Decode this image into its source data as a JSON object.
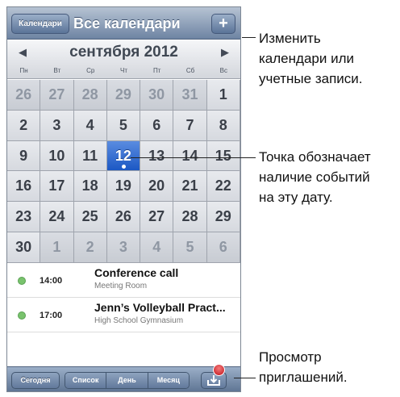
{
  "nav": {
    "calendars_button": "Календари",
    "title": "Все календари",
    "add_button": "+"
  },
  "month": {
    "title": "сентября 2012",
    "prev": "◀",
    "next": "▶",
    "weekdays": [
      "Пн",
      "Вт",
      "Ср",
      "Чт",
      "Пт",
      "Сб",
      "Вс"
    ]
  },
  "days": [
    {
      "d": "26",
      "out": true
    },
    {
      "d": "27",
      "out": true
    },
    {
      "d": "28",
      "out": true
    },
    {
      "d": "29",
      "out": true
    },
    {
      "d": "30",
      "out": true
    },
    {
      "d": "31",
      "out": true
    },
    {
      "d": "1"
    },
    {
      "d": "2"
    },
    {
      "d": "3"
    },
    {
      "d": "4"
    },
    {
      "d": "5"
    },
    {
      "d": "6"
    },
    {
      "d": "7"
    },
    {
      "d": "8"
    },
    {
      "d": "9"
    },
    {
      "d": "10"
    },
    {
      "d": "11"
    },
    {
      "d": "12",
      "selected": true,
      "has_events": true
    },
    {
      "d": "13"
    },
    {
      "d": "14"
    },
    {
      "d": "15"
    },
    {
      "d": "16"
    },
    {
      "d": "17"
    },
    {
      "d": "18"
    },
    {
      "d": "19"
    },
    {
      "d": "20"
    },
    {
      "d": "21"
    },
    {
      "d": "22"
    },
    {
      "d": "23"
    },
    {
      "d": "24"
    },
    {
      "d": "25"
    },
    {
      "d": "26"
    },
    {
      "d": "27"
    },
    {
      "d": "28"
    },
    {
      "d": "29"
    },
    {
      "d": "30"
    },
    {
      "d": "1",
      "out": true
    },
    {
      "d": "2",
      "out": true
    },
    {
      "d": "3",
      "out": true
    },
    {
      "d": "4",
      "out": true
    },
    {
      "d": "5",
      "out": true
    },
    {
      "d": "6",
      "out": true
    }
  ],
  "events": [
    {
      "time": "14:00",
      "title": "Conference call",
      "location": "Meeting Room",
      "color": "#79c36d"
    },
    {
      "time": "17:00",
      "title": "Jenn’s Volleyball Pract...",
      "location": "High School Gymnasium",
      "color": "#79c36d"
    }
  ],
  "toolbar": {
    "today": "Сегодня",
    "list": "Список",
    "day": "День",
    "month": "Месяц",
    "invitations_icon": "inbox-download-icon"
  },
  "callouts": {
    "edit_calendars": "Изменить\nкалендари или\nучетные записи.",
    "event_dot": "Точка обозначает\nналичие событий\nна эту дату.",
    "invitations": "Просмотр\nприглашений."
  }
}
